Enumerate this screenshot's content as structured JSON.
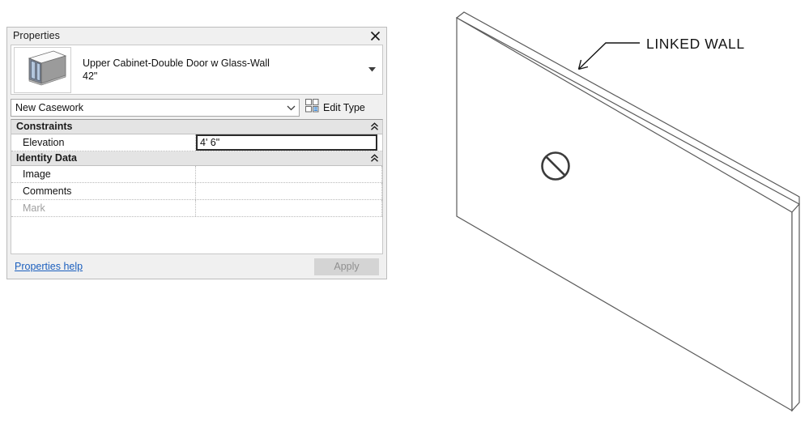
{
  "palette": {
    "title": "Properties",
    "close_icon": "close-x-icon",
    "type_header": {
      "thumbnail_icon": "upper-cabinet-glass-door-thumbnail",
      "name_line1": "Upper Cabinet-Double Door w Glass-Wall",
      "name_line2": "42\"",
      "dropdown_icon": "dropdown-triangle-icon"
    },
    "family_selector": {
      "value": "New Casework",
      "chevron_icon": "chevron-down-icon"
    },
    "edit_type": {
      "label": "Edit Type",
      "icon": "edit-type-grid-icon"
    },
    "sections": [
      {
        "name": "Constraints",
        "toggle_icon": "double-chevron-up-icon",
        "rows": [
          {
            "name": "Elevation",
            "value": "4'  6\"",
            "focused": true,
            "dimmed": false
          }
        ]
      },
      {
        "name": "Identity Data",
        "toggle_icon": "double-chevron-up-icon",
        "rows": [
          {
            "name": "Image",
            "value": "",
            "focused": false,
            "dimmed": false
          },
          {
            "name": "Comments",
            "value": "",
            "focused": false,
            "dimmed": false
          },
          {
            "name": "Mark",
            "value": "",
            "focused": false,
            "dimmed": true
          }
        ]
      }
    ],
    "footer": {
      "help_link": "Properties help",
      "apply_label": "Apply"
    }
  },
  "diagram": {
    "annotation_label": "LINKED WALL",
    "leader_icon": "leader-arrow-icon",
    "forbidden_icon": "no-entry-slash-icon",
    "wall_icon": "isometric-wall-3d"
  },
  "colors": {
    "panel_bg": "#f0f0f0",
    "section_bg": "#e4e4e4",
    "field_bg": "#ffffff",
    "link": "#1b5fbe",
    "line": "#555555",
    "text": "#111111",
    "dim_text": "#a0a0a0"
  }
}
